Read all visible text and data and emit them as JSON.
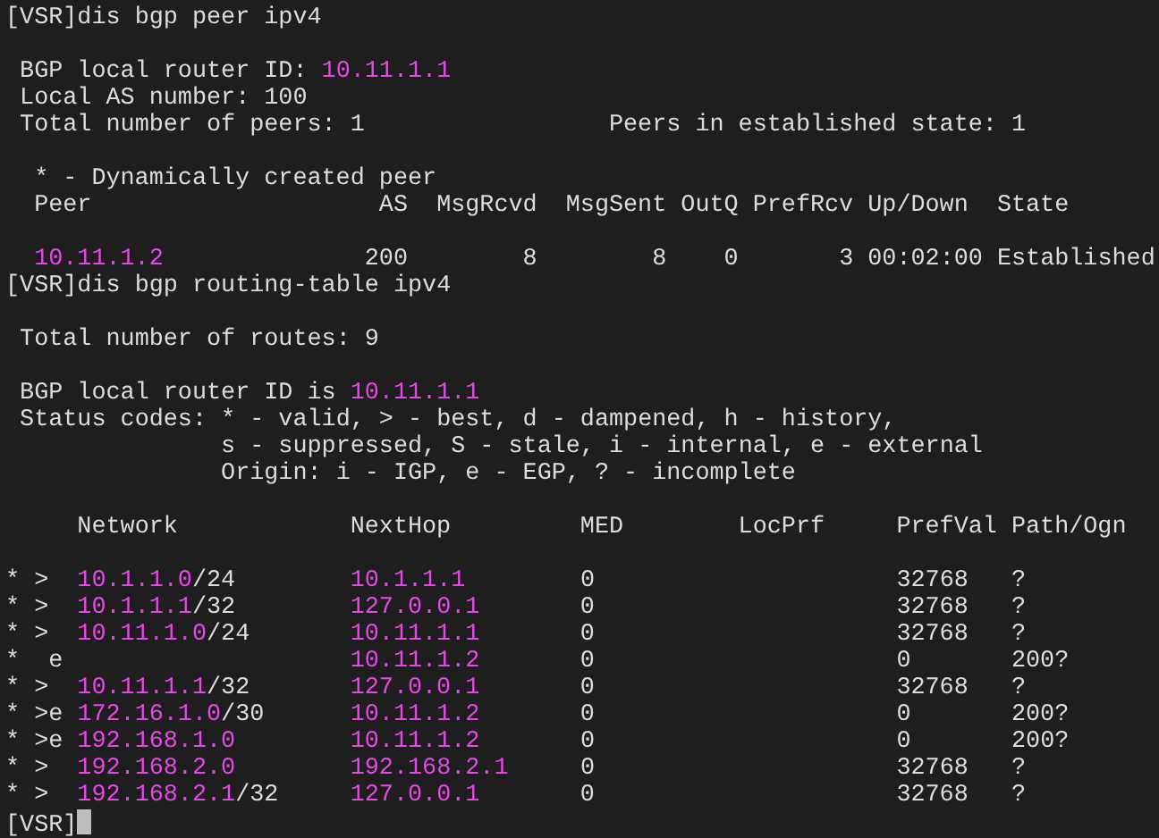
{
  "terminal": {
    "lines": [
      {
        "kind": "command",
        "prompt": "[VSR]",
        "command": "dis bgp peer ipv4",
        "cursor": false
      },
      {
        "kind": "blank"
      },
      {
        "kind": "text",
        "segments": [
          {
            "kind": "text",
            "text": "BGP local router ID: "
          },
          {
            "kind": "ip",
            "text": "10.11.1.1"
          }
        ]
      },
      {
        "kind": "text",
        "segments": [
          {
            "kind": "text",
            "text": "Local AS number: 100"
          }
        ]
      },
      {
        "kind": "pair",
        "left": "Total number of peers: 1",
        "right": "Peers in established state: 1"
      },
      {
        "kind": "blank"
      },
      {
        "kind": "peer-table",
        "note": "* - Dynamically created peer",
        "columns": [
          "Peer",
          "AS",
          "MsgRcvd",
          "MsgSent",
          "OutQ",
          "PrefRcv",
          "Up/Down",
          "State"
        ],
        "rows": [
          [
            "10.11.1.2",
            "200",
            "8",
            "8",
            "0",
            "3",
            "00:02:00",
            "Established"
          ]
        ]
      },
      {
        "kind": "command",
        "prompt": "[VSR]",
        "command": "dis bgp routing-table ipv4",
        "cursor": false
      },
      {
        "kind": "blank"
      },
      {
        "kind": "text",
        "segments": [
          {
            "kind": "text",
            "text": "Total number of routes: 9"
          }
        ]
      },
      {
        "kind": "blank"
      },
      {
        "kind": "text",
        "segments": [
          {
            "kind": "text",
            "text": "BGP local router ID is "
          },
          {
            "kind": "ip",
            "text": "10.11.1.1"
          }
        ]
      },
      {
        "kind": "legend",
        "label": "Status codes:",
        "lines": [
          "* - valid, > - best, d - dampened, h - history,",
          "s - suppressed, S - stale, i - internal, e - external",
          "Origin: i - IGP, e - EGP, ? - incomplete"
        ]
      },
      {
        "kind": "blank"
      },
      {
        "kind": "route-table",
        "columns": [
          "Network",
          "NextHop",
          "MED",
          "LocPrf",
          "PrefVal",
          "Path/Ogn"
        ],
        "rows": [
          {
            "status": "* >",
            "network": "10.1.1.0",
            "mask": "/24",
            "next_hop": "10.1.1.1",
            "med": "0",
            "pref_val": "32768",
            "path": "?"
          },
          {
            "status": "* >",
            "network": "10.1.1.1",
            "mask": "/32",
            "next_hop": "127.0.0.1",
            "med": "0",
            "pref_val": "32768",
            "path": "?"
          },
          {
            "status": "* >",
            "network": "10.11.1.0",
            "mask": "/24",
            "next_hop": "10.11.1.1",
            "med": "0",
            "pref_val": "32768",
            "path": "?"
          },
          {
            "status": "*  e",
            "next_hop": "10.11.1.2",
            "med": "0",
            "pref_val": "0",
            "path": "200?"
          },
          {
            "status": "* >",
            "network": "10.11.1.1",
            "mask": "/32",
            "next_hop": "127.0.0.1",
            "med": "0",
            "pref_val": "32768",
            "path": "?"
          },
          {
            "status": "* >e",
            "network": "172.16.1.0",
            "mask": "/30",
            "next_hop": "10.11.1.2",
            "med": "0",
            "pref_val": "0",
            "path": "200?"
          },
          {
            "status": "* >e",
            "network": "192.168.1.0",
            "next_hop": "10.11.1.2",
            "med": "0",
            "pref_val": "0",
            "path": "200?"
          },
          {
            "status": "* >",
            "network": "192.168.2.0",
            "next_hop": "192.168.2.1",
            "med": "0",
            "pref_val": "32768",
            "path": "?"
          },
          {
            "status": "* >",
            "network": "192.168.2.1",
            "mask": "/32",
            "next_hop": "127.0.0.1",
            "med": "0",
            "pref_val": "32768",
            "path": "?"
          }
        ]
      },
      {
        "kind": "command",
        "prompt": "[VSR]",
        "cursor": true
      }
    ]
  }
}
